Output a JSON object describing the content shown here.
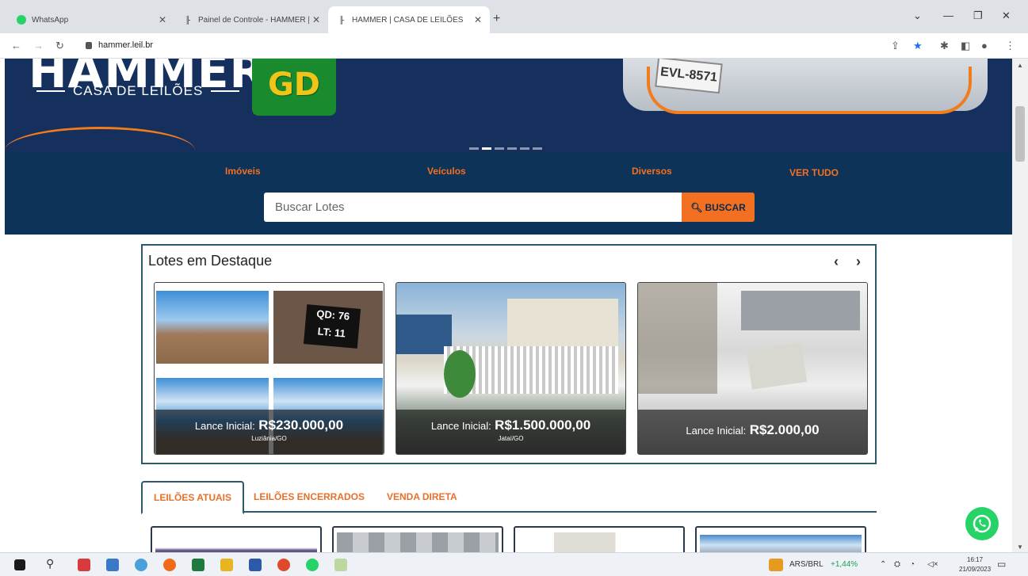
{
  "tabs": [
    {
      "title": "WhatsApp"
    },
    {
      "title": "Painel de Controle - HAMMER | C"
    },
    {
      "title": "HAMMER | CASA DE LEILÕES"
    }
  ],
  "address": {
    "url": "hammer.leil.br"
  },
  "banner": {
    "brand": "HAMMER",
    "brand_sub": "CASA DE LEILÕES",
    "partner_logo": "GD",
    "plate": "EVL-8571"
  },
  "categories": [
    "Imóveis",
    "Veículos",
    "Diversos",
    "VER TUDO"
  ],
  "search": {
    "placeholder": "Buscar Lotes",
    "button": "BUSCAR"
  },
  "featured": {
    "title": "Lotes em Destaque",
    "cards": [
      {
        "label": "Lance Inicial:",
        "price": "R$230.000,00",
        "location": "Luziânia/GO"
      },
      {
        "label": "Lance Inicial:",
        "price": "R$1.500.000,00",
        "location": "Jataí/GO"
      },
      {
        "label": "Lance Inicial:",
        "price": "R$2.000,00",
        "location": ""
      }
    ]
  },
  "auction_tabs": [
    "LEILÕES ATUAIS",
    "LEILÕES ENCERRADOS",
    "VENDA DIRETA"
  ],
  "taskbar": {
    "ticker": "ARS/BRL",
    "ticker_change": "+1,44%",
    "time": "16:17",
    "date": "21/09/2023"
  }
}
